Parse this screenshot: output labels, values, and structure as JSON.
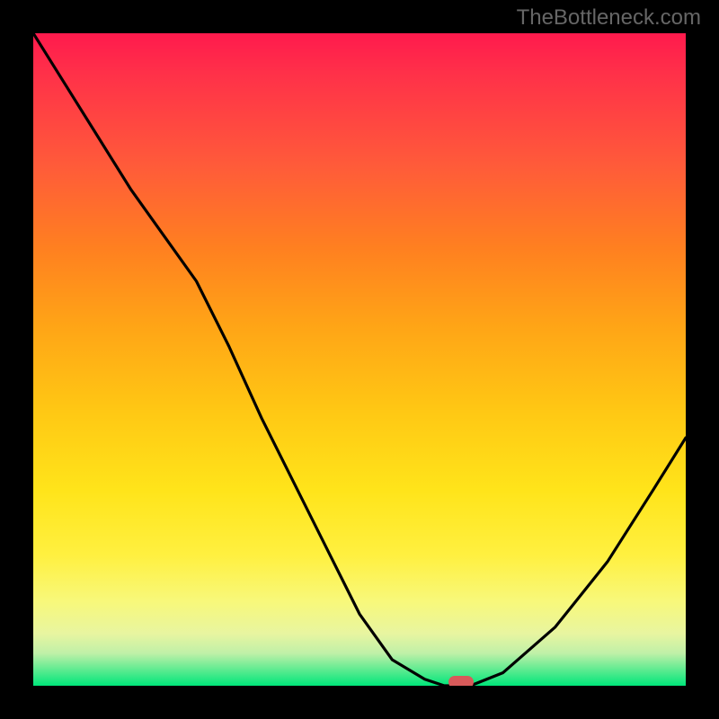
{
  "watermark": "TheBottleneck.com",
  "chart_data": {
    "type": "line",
    "title": "",
    "xlabel": "",
    "ylabel": "",
    "x": [
      0.0,
      0.05,
      0.1,
      0.15,
      0.2,
      0.25,
      0.3,
      0.35,
      0.4,
      0.45,
      0.5,
      0.55,
      0.6,
      0.63,
      0.67,
      0.72,
      0.8,
      0.88,
      0.95,
      1.0
    ],
    "y": [
      1.0,
      0.92,
      0.84,
      0.76,
      0.69,
      0.62,
      0.52,
      0.41,
      0.31,
      0.21,
      0.11,
      0.04,
      0.01,
      0.0,
      0.0,
      0.02,
      0.09,
      0.19,
      0.3,
      0.38
    ],
    "xlim": [
      0,
      1
    ],
    "ylim": [
      0,
      1
    ],
    "gradient_colors": {
      "top": "#ff1a4d",
      "mid": "#ffe41a",
      "bottom": "#00e67a"
    },
    "marker": {
      "x": 0.655,
      "y": 0.005,
      "color": "#d85a5a"
    }
  }
}
